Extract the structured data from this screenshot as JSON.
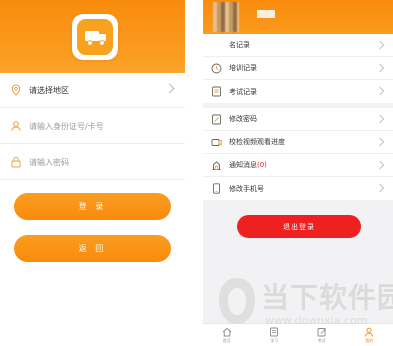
{
  "colors": {
    "accent": "#f98b0c",
    "accent_light": "#fb9d22",
    "danger": "#ee2020",
    "background": "#f2f2f4"
  },
  "login": {
    "region_placeholder": "请选择地区",
    "id_placeholder": "请输入身份证号/卡号",
    "password_placeholder": "请输入密码",
    "login_button": "登 录",
    "back_button": "返 回"
  },
  "profile": {
    "menu_group_1": [
      {
        "icon": "study-record-icon",
        "label": "名记录"
      },
      {
        "icon": "clock-icon",
        "label": "培训记录"
      },
      {
        "icon": "exam-icon",
        "label": "考试记录"
      }
    ],
    "menu_group_2": [
      {
        "icon": "lock-icon",
        "label": "修改密码"
      },
      {
        "icon": "video-icon",
        "label": "校检视频观看进度"
      },
      {
        "icon": "notice-icon",
        "label": "通知消息",
        "badge": "(0)"
      },
      {
        "icon": "phone-icon",
        "label": "修改手机号"
      }
    ],
    "logout_button": "退出登录"
  },
  "tabbar": [
    {
      "icon": "home-icon",
      "label": "首页"
    },
    {
      "icon": "study-icon",
      "label": "学习"
    },
    {
      "icon": "edit-icon",
      "label": "考试"
    },
    {
      "icon": "user-icon",
      "label": "我的",
      "active": true
    }
  ],
  "watermark": {
    "text": "当下软件园",
    "url": "www.downxia.com"
  }
}
